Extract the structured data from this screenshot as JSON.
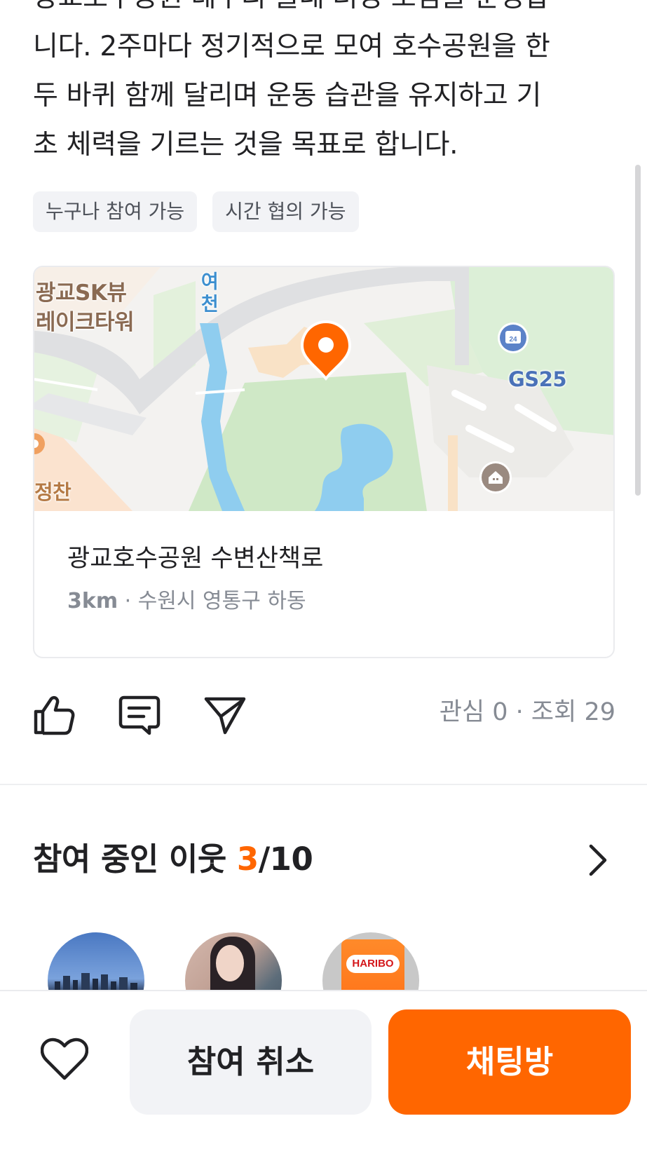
{
  "post": {
    "description_lines": [
      "광교호수공원 테두리 둘레 러닝 모임을 운영합",
      "니다. 2주마다 정기적으로 모여 호수공원을 한",
      "두 바퀴 함께 달리며 운동 습관을 유지하고 기",
      "초 체력을 기르는 것을 목표로 합니다."
    ],
    "tags": [
      "누구나 참여 가능",
      "시간 협의 가능"
    ]
  },
  "map": {
    "labels": {
      "sk": "광교SK뷰\n레이크타워",
      "stream": "여천",
      "jeongchan": "정찬",
      "gs25": "GS25",
      "gs25_badge": "24"
    },
    "pin_color": "#ff6600"
  },
  "place": {
    "name": "광교호수공원 수변산책로",
    "distance": "3km",
    "separator": " · ",
    "address": "수원시 영통구 하동"
  },
  "actions": {
    "like_icon": "thumbs-up-icon",
    "comment_icon": "comment-icon",
    "share_icon": "send-icon"
  },
  "stats": {
    "text": "관심 0 · 조회 29"
  },
  "participants": {
    "title": "참여 중인 이웃 ",
    "current": "3",
    "max_text": "/10",
    "avatar_haribo_text": "HARIBO"
  },
  "bottom_bar": {
    "favorite_icon": "heart-icon",
    "cancel_label": "참여 취소",
    "chat_label": "채팅방"
  },
  "colors": {
    "accent": "#ff6600",
    "text_primary": "#212124",
    "text_secondary": "#868b94",
    "chip_bg": "#f2f3f6"
  }
}
